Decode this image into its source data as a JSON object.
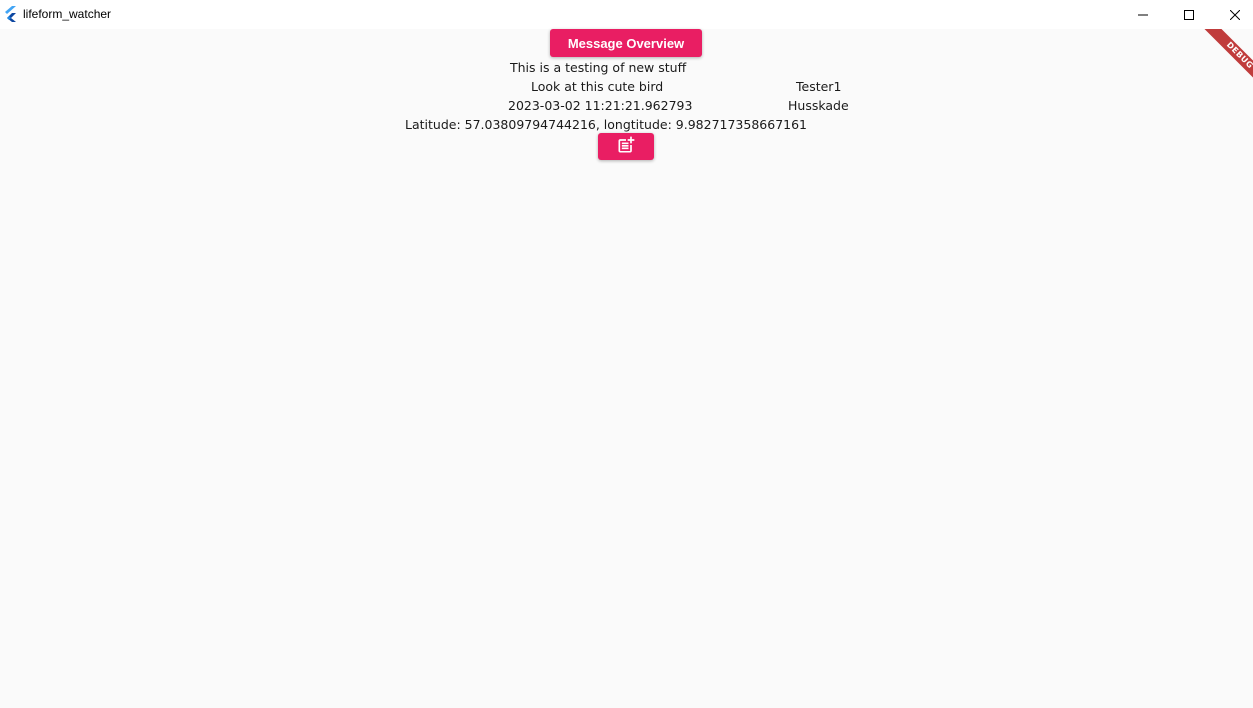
{
  "window": {
    "title": "lifeform_watcher",
    "icon": "flutter-logo-icon",
    "controls": [
      "minimize-icon",
      "maximize-icon",
      "close-icon"
    ]
  },
  "debug_banner": "DEBUG",
  "header": {
    "overview_button_label": "Message Overview"
  },
  "message": {
    "description": "This is a testing of new stuff",
    "title": "Look at this cute bird",
    "timestamp": "2023-03-02 11:21:21.962793",
    "author": "Tester1",
    "location_name": "Husskade",
    "coordinates": "Latitude: 57.03809794744216, longtitude: 9.982717358667161"
  },
  "actions": {
    "add_icon": "post-add-icon"
  },
  "colors": {
    "accent": "#e91e63",
    "background": "#fafafa",
    "debug_ribbon": "#b71c1c"
  }
}
